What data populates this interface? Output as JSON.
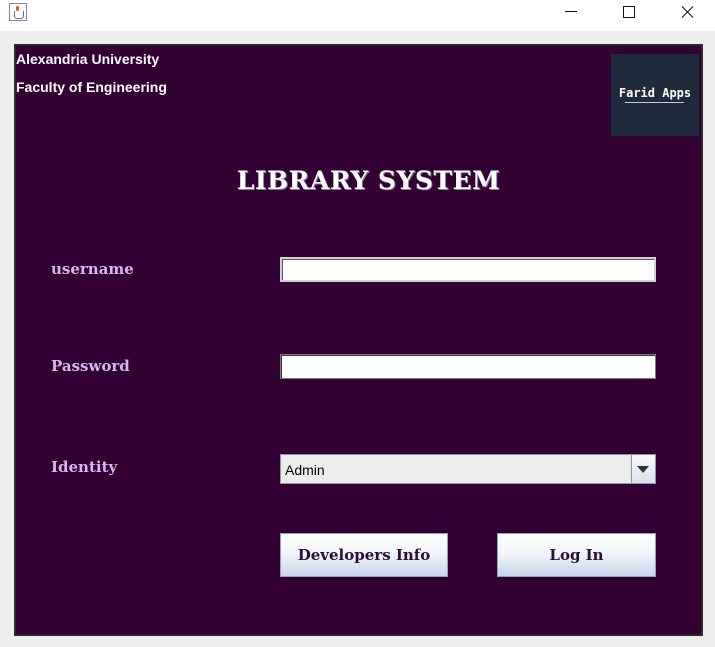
{
  "window": {
    "icon": "java-cup-icon",
    "controls": [
      "minimize-icon",
      "maximize-icon",
      "close-icon"
    ]
  },
  "header": {
    "university": "Alexandria University",
    "faculty": "Faculty of Engineering",
    "logo_text": "Farid Apps"
  },
  "main": {
    "title": "LIBRARY SYSTEM",
    "username_label": "username",
    "username_value": "",
    "password_label": "Password",
    "password_value": "",
    "identity_label": "Identity",
    "identity_selected": "Admin",
    "developers_button": "Developers Info",
    "login_button": "Log In"
  },
  "colors": {
    "panel_bg": "#320032",
    "label_color": "#d2b8f0",
    "logo_bg": "#1f2a3c"
  }
}
